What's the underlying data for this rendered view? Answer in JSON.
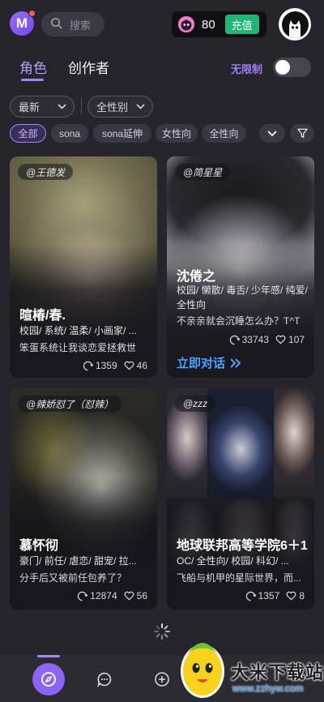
{
  "header": {
    "logo_letter": "M",
    "search_placeholder": "搜索",
    "coin_count": "80",
    "recharge_label": "充值"
  },
  "tabs": [
    {
      "label": "角色",
      "active": true
    },
    {
      "label": "创作者",
      "active": false
    }
  ],
  "unlimited": {
    "label": "无限制",
    "enabled": false
  },
  "filters": {
    "sort_value": "最新",
    "gender_value": "全性别"
  },
  "chips": [
    {
      "label": "全部",
      "active": true
    },
    {
      "label": "sona",
      "active": false
    },
    {
      "label": "sona延伸",
      "active": false
    },
    {
      "label": "女性向",
      "active": false
    },
    {
      "label": "全性向",
      "active": false
    }
  ],
  "cards": [
    {
      "author": "@王德发",
      "name": "暄椿/春.",
      "tags": "校园/ 系统/ 温柔/ 小画家/ ...",
      "desc": "笨蛋系统让我谈恋爱拯救世",
      "shares": "1359",
      "likes": "46"
    },
    {
      "author": "@简星星",
      "name": "沈倦之",
      "tags": "校园/ 懒散/ 毒舌/ 少年感/ 纯爱/ 全性向",
      "desc": "不亲亲就会沉睡怎么办？T^T",
      "shares": "33743",
      "likes": "107",
      "cta": "立即对话"
    },
    {
      "author": "@辣娇怼了（怼辣）",
      "name": "慕怀彻",
      "tags": "豪门/ 前任/ 虐恋/ 甜宠/ 拉...",
      "desc": "分手后又被前任包养了？",
      "shares": "12874",
      "likes": "56"
    },
    {
      "author": "@zzz",
      "name": "地球联邦高等学院6＋1",
      "tags": "OC/ 全性向/ 校园/ 科幻/ ...",
      "desc": "飞船与机甲的星际世界，而...",
      "shares": "1357",
      "likes": "8"
    }
  ],
  "watermark": {
    "title": "大米下载站",
    "url": "www.zzhyw.com"
  },
  "colors": {
    "background": "#26252c",
    "accent": "#a785ff",
    "recharge": "#21b576",
    "cta": "#4aa3ff"
  }
}
